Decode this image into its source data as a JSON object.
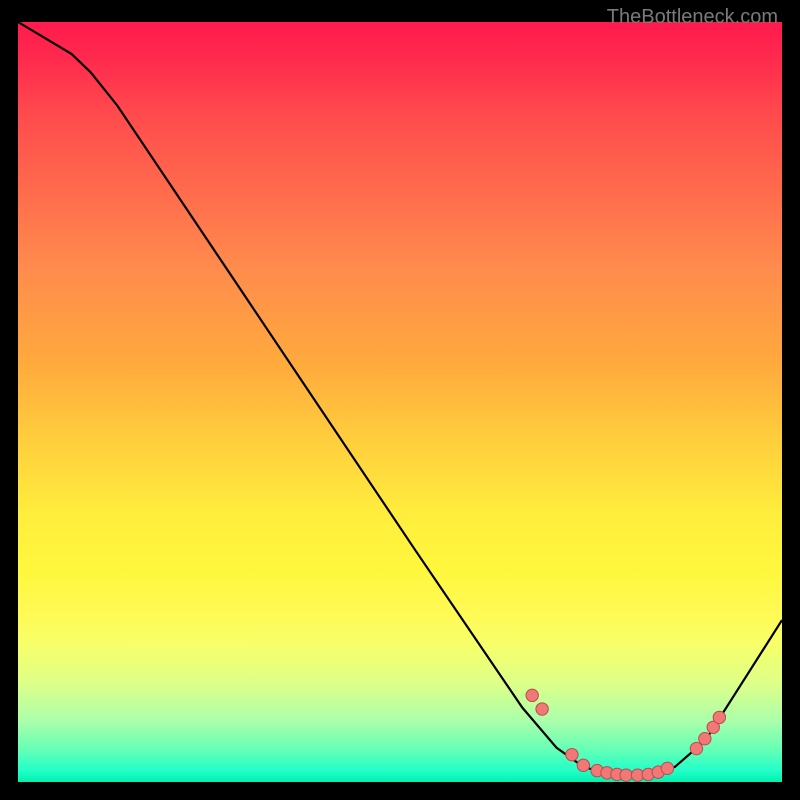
{
  "attribution": "TheBottleneck.com",
  "chart_data": {
    "type": "line",
    "title": "",
    "xlabel": "",
    "ylabel": "",
    "xlim": [
      0,
      100
    ],
    "ylim": [
      0,
      100
    ],
    "curve": [
      {
        "x": 0,
        "y": 100
      },
      {
        "x": 7,
        "y": 95.8
      },
      {
        "x": 9.5,
        "y": 93.4
      },
      {
        "x": 13,
        "y": 89.0
      },
      {
        "x": 30,
        "y": 63.5
      },
      {
        "x": 52,
        "y": 30.5
      },
      {
        "x": 66,
        "y": 9.8
      },
      {
        "x": 70.5,
        "y": 4.5
      },
      {
        "x": 74,
        "y": 2.0
      },
      {
        "x": 78,
        "y": 0.8
      },
      {
        "x": 82,
        "y": 0.8
      },
      {
        "x": 86,
        "y": 2.0
      },
      {
        "x": 90,
        "y": 5.5
      },
      {
        "x": 100,
        "y": 21.3
      }
    ],
    "dots": [
      {
        "x": 67.3,
        "y": 11.4
      },
      {
        "x": 68.6,
        "y": 9.6
      },
      {
        "x": 72.5,
        "y": 3.6
      },
      {
        "x": 74.0,
        "y": 2.2
      },
      {
        "x": 75.8,
        "y": 1.5
      },
      {
        "x": 77.1,
        "y": 1.2
      },
      {
        "x": 78.4,
        "y": 1.0
      },
      {
        "x": 79.6,
        "y": 0.9
      },
      {
        "x": 81.1,
        "y": 0.9
      },
      {
        "x": 82.5,
        "y": 1.0
      },
      {
        "x": 83.8,
        "y": 1.3
      },
      {
        "x": 85.0,
        "y": 1.8
      },
      {
        "x": 88.8,
        "y": 4.4
      },
      {
        "x": 89.9,
        "y": 5.7
      },
      {
        "x": 91.0,
        "y": 7.2
      },
      {
        "x": 91.8,
        "y": 8.5
      }
    ]
  }
}
